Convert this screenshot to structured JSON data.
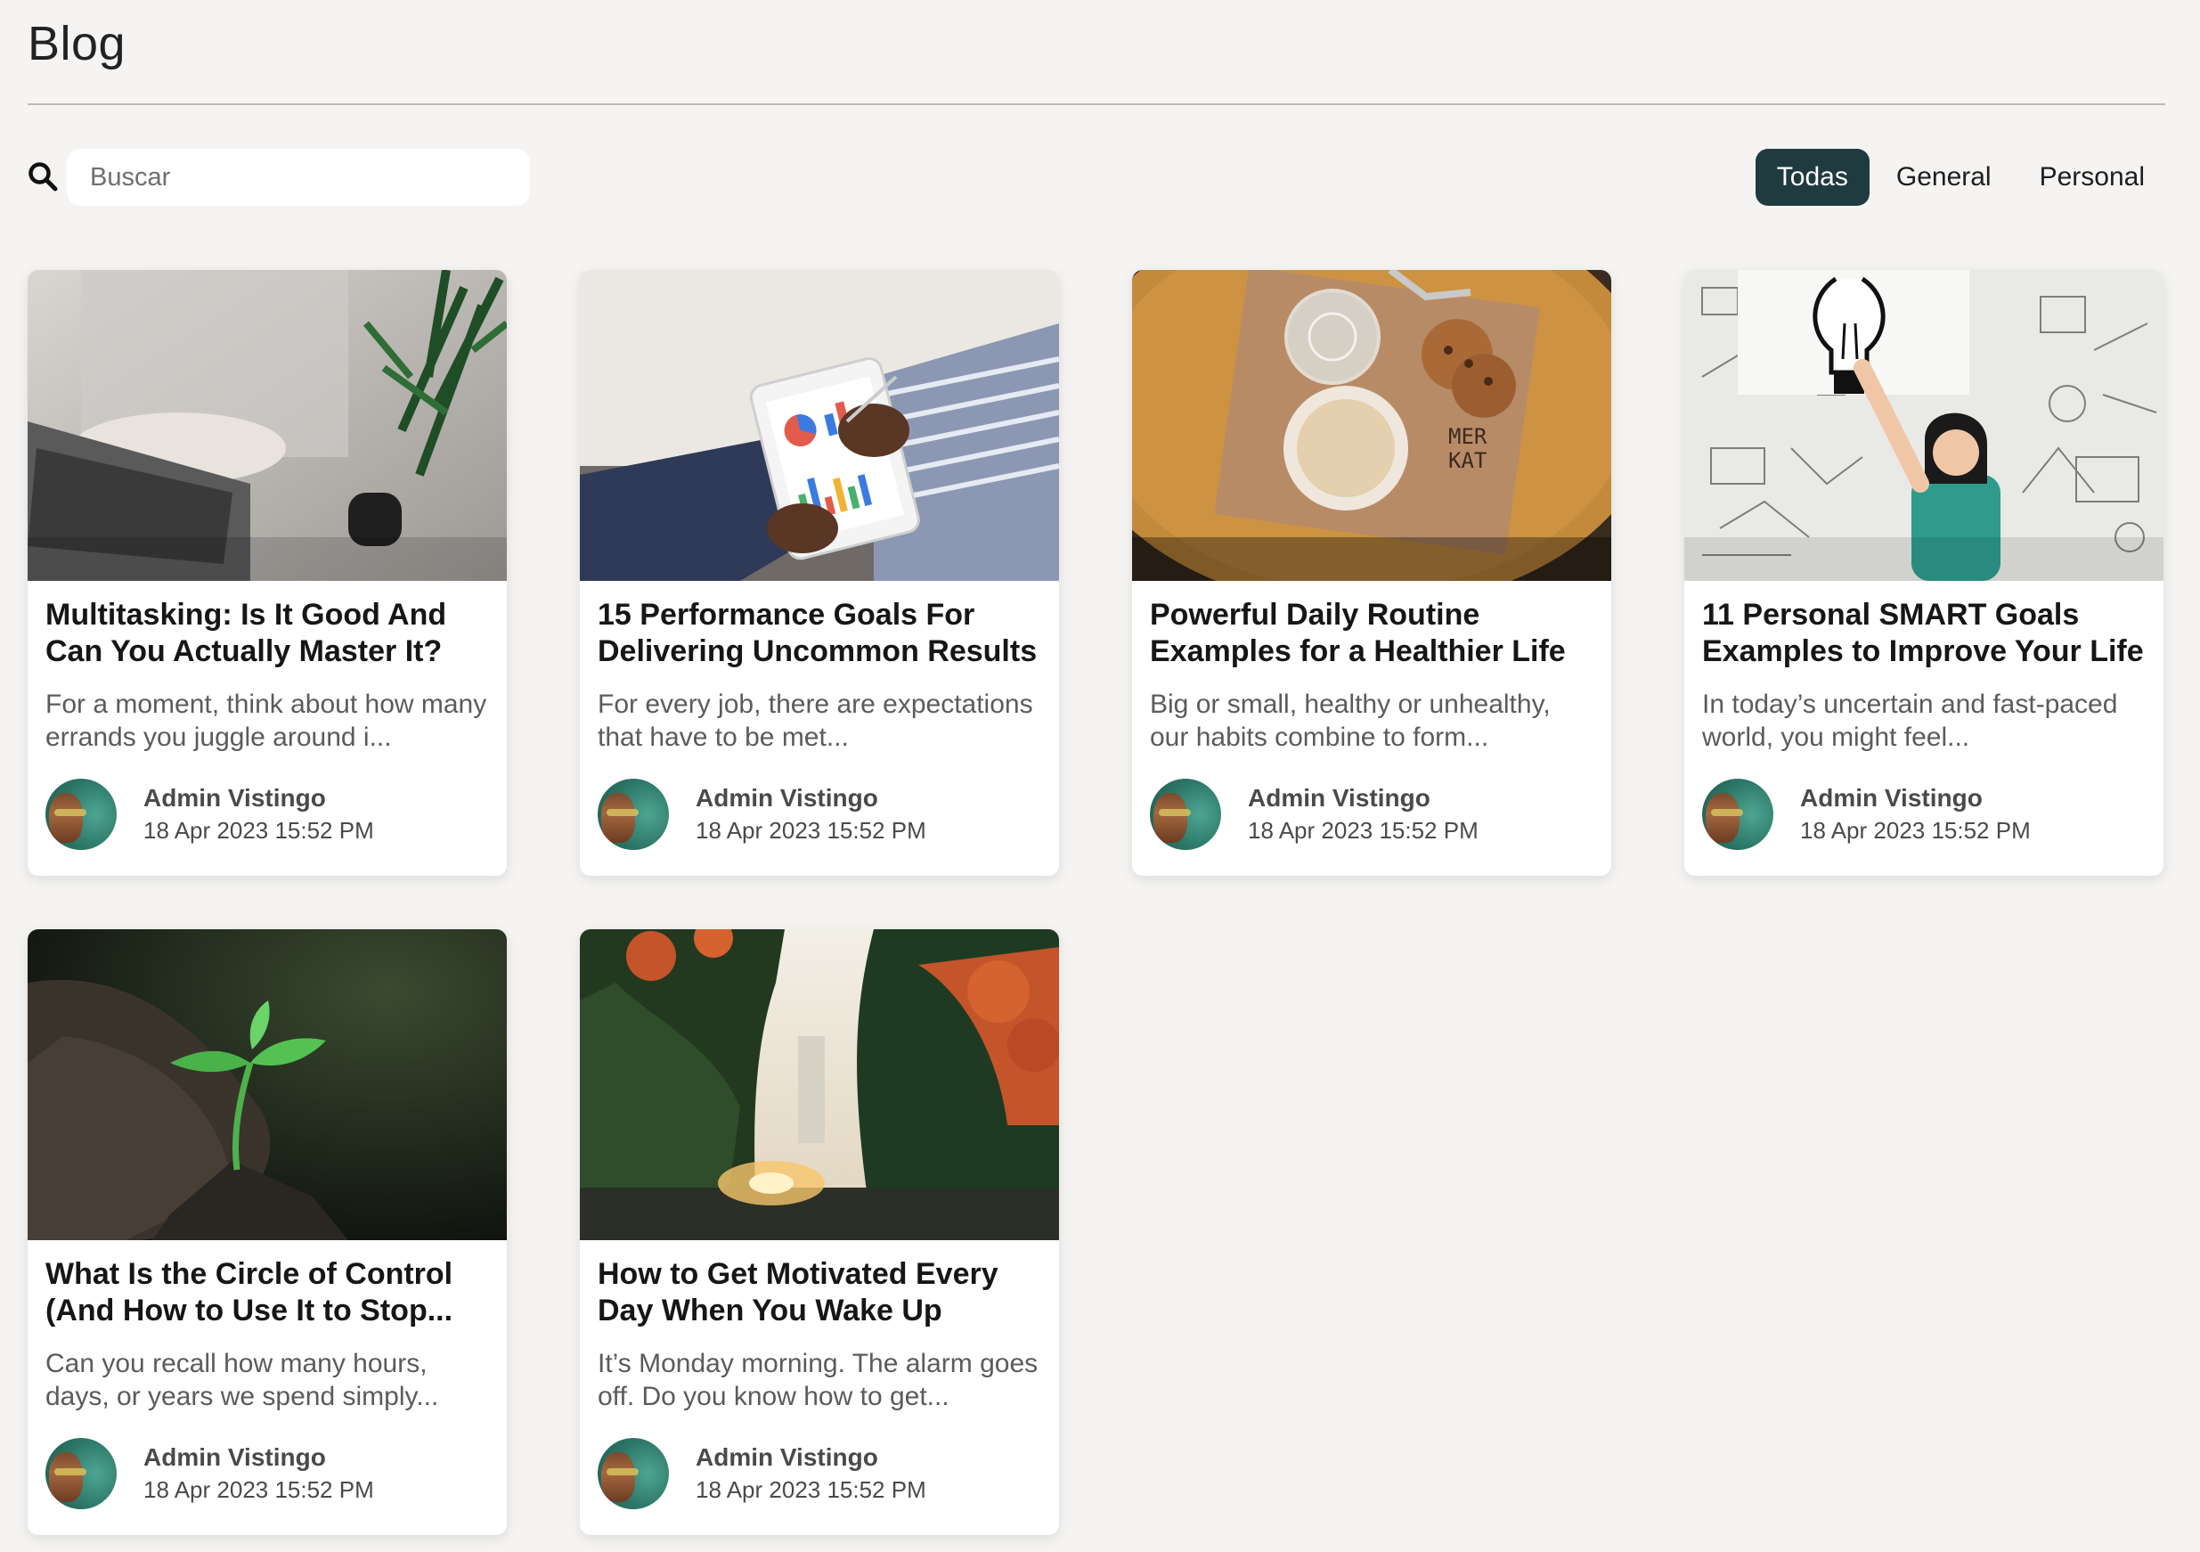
{
  "page": {
    "title": "Blog"
  },
  "search": {
    "placeholder": "Buscar"
  },
  "filters": [
    {
      "label": "Todas",
      "active": true
    },
    {
      "label": "General",
      "active": false
    },
    {
      "label": "Personal",
      "active": false
    }
  ],
  "posts": [
    {
      "title": "Multitasking: Is It Good And Can You Actually Master It?",
      "excerpt": "For a moment, think about how many errands you juggle around i...",
      "author": "Admin Vistingo",
      "date": "18 Apr 2023 15:52 PM",
      "image": "laptop-typing"
    },
    {
      "title": "15 Performance Goals For Delivering Uncommon Results",
      "excerpt": "For every job, there are expectations that have to be met...",
      "author": "Admin Vistingo",
      "date": "18 Apr 2023 15:52 PM",
      "image": "tablet-charts"
    },
    {
      "title": "Powerful Daily Routine Examples for a Healthier Life",
      "excerpt": "Big or small, healthy or unhealthy, our habits combine to form...",
      "author": "Admin Vistingo",
      "date": "18 Apr 2023 15:52 PM",
      "image": "coffee-cookies"
    },
    {
      "title": "11 Personal SMART Goals Examples to Improve Your Life",
      "excerpt": "In today’s uncertain and fast-paced world, you might feel...",
      "author": "Admin Vistingo",
      "date": "18 Apr 2023 15:52 PM",
      "image": "lightbulb-sketch"
    },
    {
      "title": "What Is the Circle of Control (And How to Use It to Stop...",
      "excerpt": "Can you recall how many hours, days, or years we spend simply...",
      "author": "Admin Vistingo",
      "date": "18 Apr 2023 15:52 PM",
      "image": "sprout"
    },
    {
      "title": "How to Get Motivated Every Day When You Wake Up",
      "excerpt": "It’s Monday morning. The alarm goes off. Do you know how to get...",
      "author": "Admin Vistingo",
      "date": "18 Apr 2023 15:52 PM",
      "image": "trees-sunrise"
    }
  ]
}
